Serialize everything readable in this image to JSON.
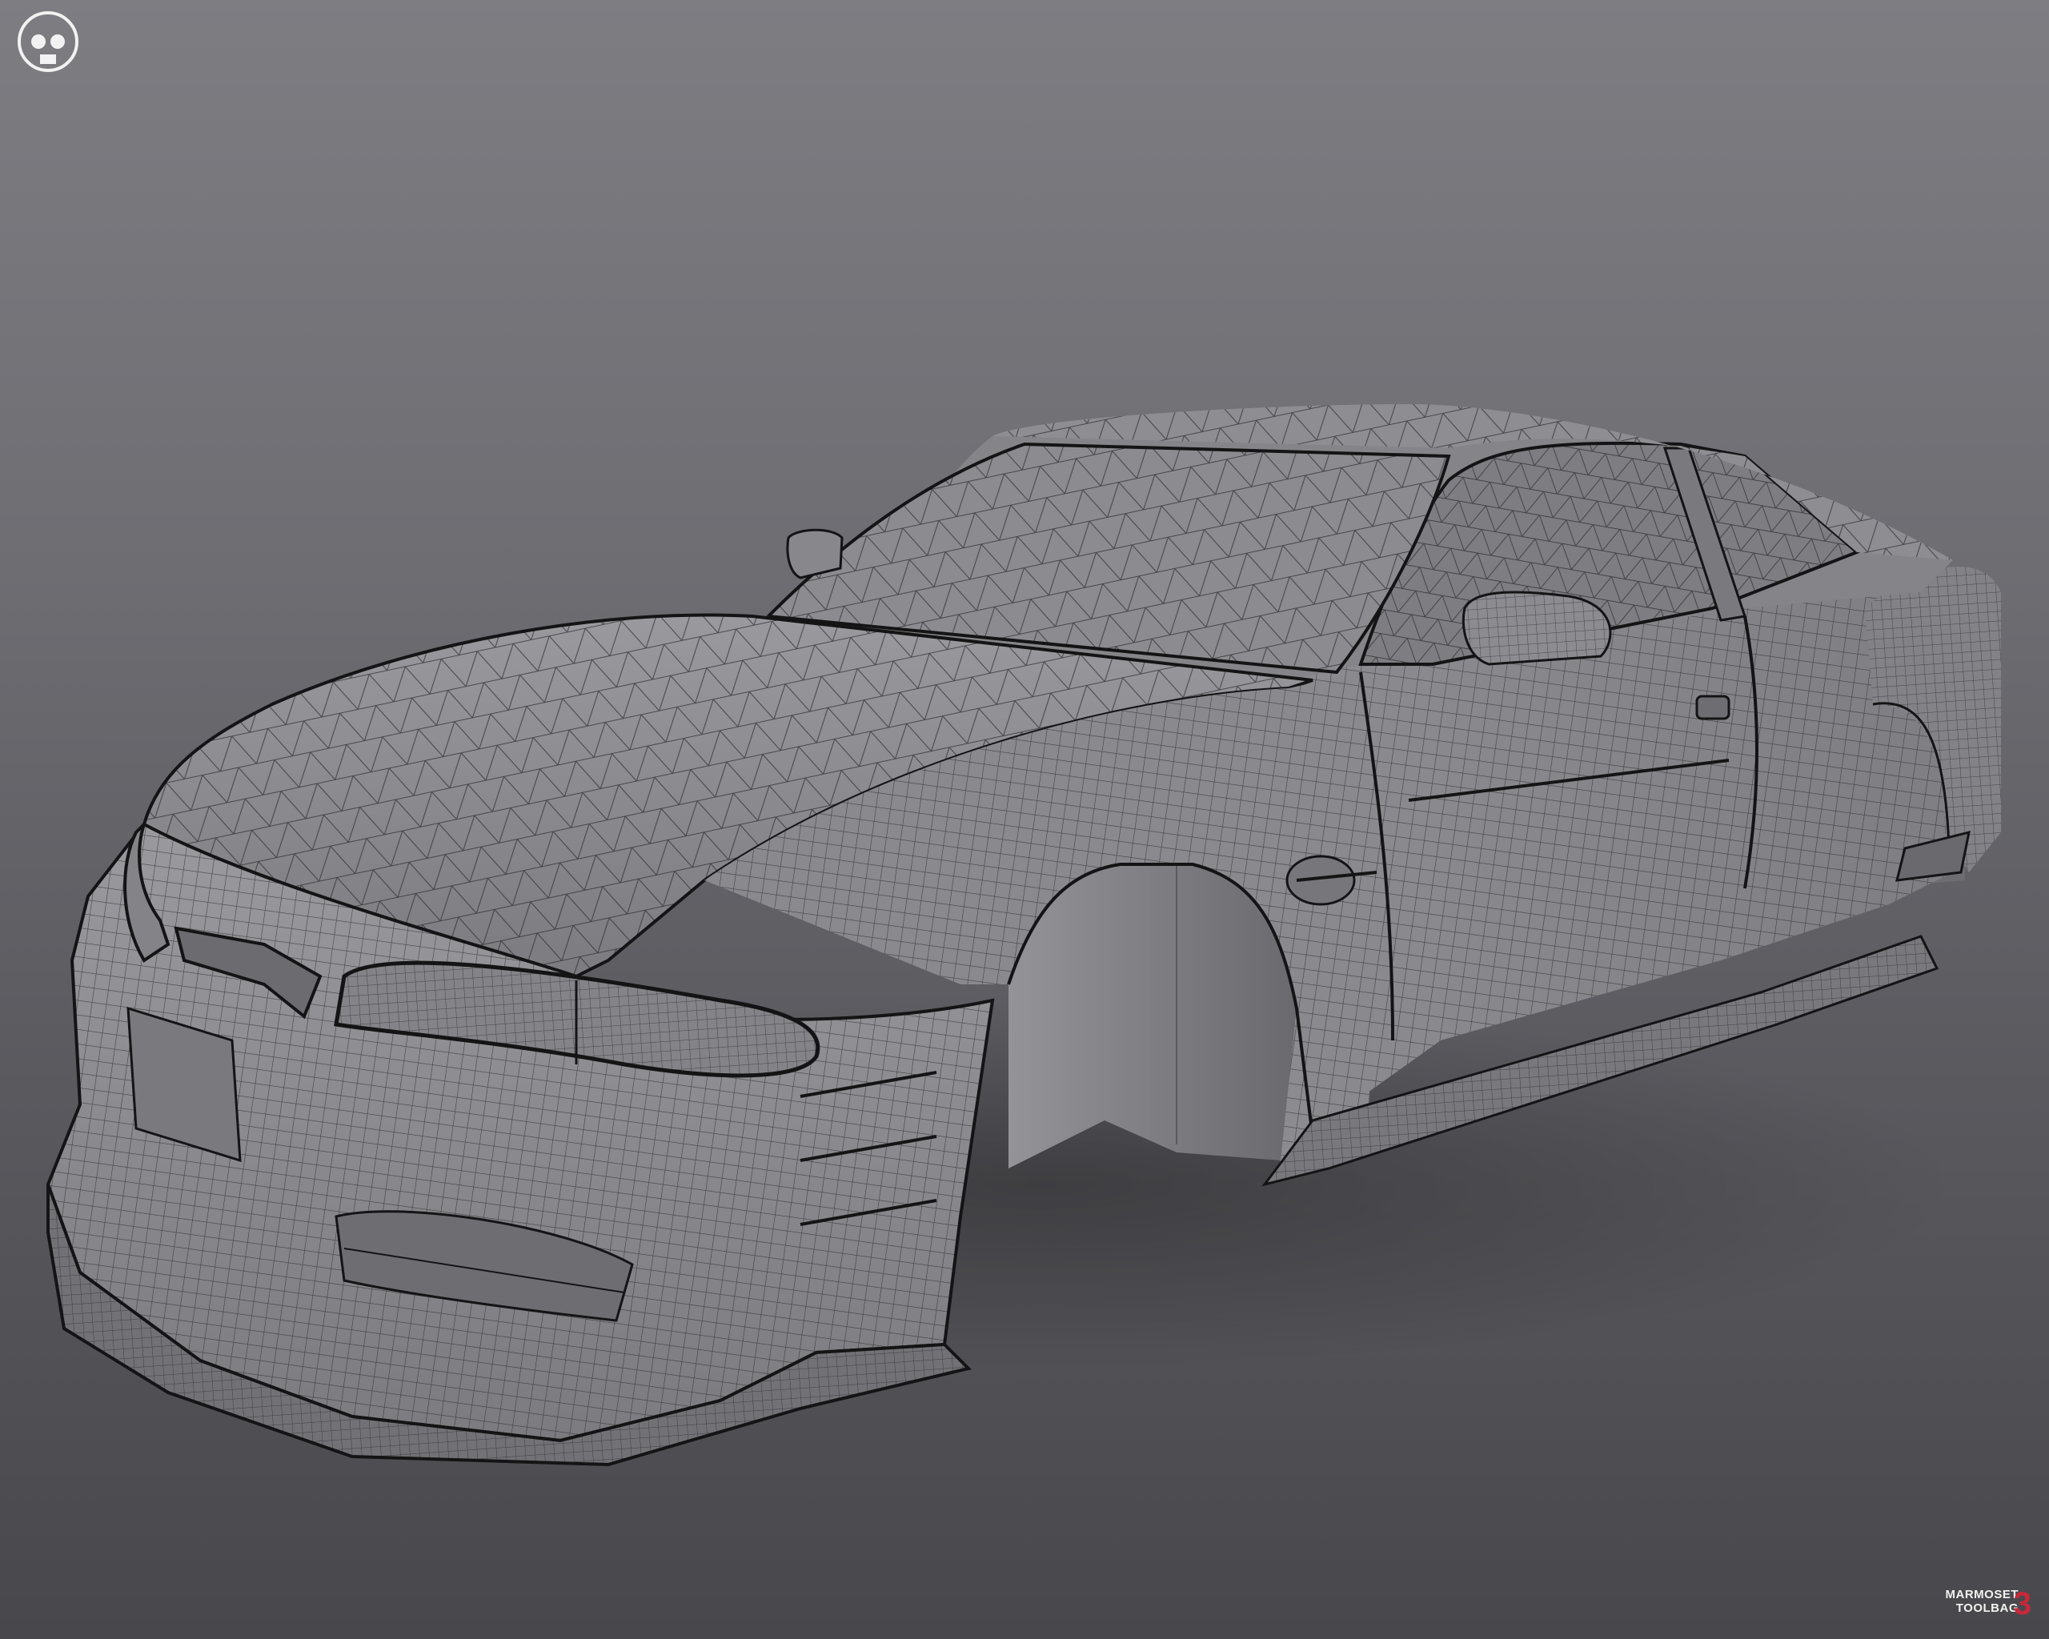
{
  "scene": {
    "subject": "car-body-wireframe",
    "background_top": "#7d7d82",
    "background_bottom": "#48484c",
    "body_color": "#8b8b8f",
    "wire_color": "#2a2a2d",
    "outline_color": "#141416"
  },
  "watermark": {
    "brand_line1": "MARMOSET",
    "brand_line2": "TOOLBAG",
    "version": "3",
    "brand_color": "#f2f2f2",
    "version_color": "#c8283a"
  }
}
